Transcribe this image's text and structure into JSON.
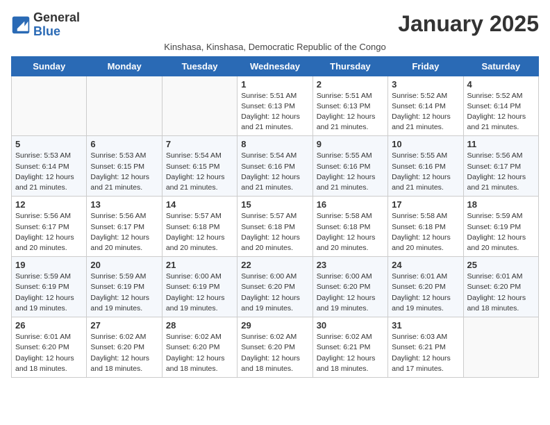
{
  "header": {
    "logo_general": "General",
    "logo_blue": "Blue",
    "month": "January 2025",
    "subtitle": "Kinshasa, Kinshasa, Democratic Republic of the Congo"
  },
  "weekdays": [
    "Sunday",
    "Monday",
    "Tuesday",
    "Wednesday",
    "Thursday",
    "Friday",
    "Saturday"
  ],
  "weeks": [
    [
      {
        "num": "",
        "info": ""
      },
      {
        "num": "",
        "info": ""
      },
      {
        "num": "",
        "info": ""
      },
      {
        "num": "1",
        "info": "Sunrise: 5:51 AM\nSunset: 6:13 PM\nDaylight: 12 hours\nand 21 minutes."
      },
      {
        "num": "2",
        "info": "Sunrise: 5:51 AM\nSunset: 6:13 PM\nDaylight: 12 hours\nand 21 minutes."
      },
      {
        "num": "3",
        "info": "Sunrise: 5:52 AM\nSunset: 6:14 PM\nDaylight: 12 hours\nand 21 minutes."
      },
      {
        "num": "4",
        "info": "Sunrise: 5:52 AM\nSunset: 6:14 PM\nDaylight: 12 hours\nand 21 minutes."
      }
    ],
    [
      {
        "num": "5",
        "info": "Sunrise: 5:53 AM\nSunset: 6:14 PM\nDaylight: 12 hours\nand 21 minutes."
      },
      {
        "num": "6",
        "info": "Sunrise: 5:53 AM\nSunset: 6:15 PM\nDaylight: 12 hours\nand 21 minutes."
      },
      {
        "num": "7",
        "info": "Sunrise: 5:54 AM\nSunset: 6:15 PM\nDaylight: 12 hours\nand 21 minutes."
      },
      {
        "num": "8",
        "info": "Sunrise: 5:54 AM\nSunset: 6:16 PM\nDaylight: 12 hours\nand 21 minutes."
      },
      {
        "num": "9",
        "info": "Sunrise: 5:55 AM\nSunset: 6:16 PM\nDaylight: 12 hours\nand 21 minutes."
      },
      {
        "num": "10",
        "info": "Sunrise: 5:55 AM\nSunset: 6:16 PM\nDaylight: 12 hours\nand 21 minutes."
      },
      {
        "num": "11",
        "info": "Sunrise: 5:56 AM\nSunset: 6:17 PM\nDaylight: 12 hours\nand 21 minutes."
      }
    ],
    [
      {
        "num": "12",
        "info": "Sunrise: 5:56 AM\nSunset: 6:17 PM\nDaylight: 12 hours\nand 20 minutes."
      },
      {
        "num": "13",
        "info": "Sunrise: 5:56 AM\nSunset: 6:17 PM\nDaylight: 12 hours\nand 20 minutes."
      },
      {
        "num": "14",
        "info": "Sunrise: 5:57 AM\nSunset: 6:18 PM\nDaylight: 12 hours\nand 20 minutes."
      },
      {
        "num": "15",
        "info": "Sunrise: 5:57 AM\nSunset: 6:18 PM\nDaylight: 12 hours\nand 20 minutes."
      },
      {
        "num": "16",
        "info": "Sunrise: 5:58 AM\nSunset: 6:18 PM\nDaylight: 12 hours\nand 20 minutes."
      },
      {
        "num": "17",
        "info": "Sunrise: 5:58 AM\nSunset: 6:18 PM\nDaylight: 12 hours\nand 20 minutes."
      },
      {
        "num": "18",
        "info": "Sunrise: 5:59 AM\nSunset: 6:19 PM\nDaylight: 12 hours\nand 20 minutes."
      }
    ],
    [
      {
        "num": "19",
        "info": "Sunrise: 5:59 AM\nSunset: 6:19 PM\nDaylight: 12 hours\nand 19 minutes."
      },
      {
        "num": "20",
        "info": "Sunrise: 5:59 AM\nSunset: 6:19 PM\nDaylight: 12 hours\nand 19 minutes."
      },
      {
        "num": "21",
        "info": "Sunrise: 6:00 AM\nSunset: 6:19 PM\nDaylight: 12 hours\nand 19 minutes."
      },
      {
        "num": "22",
        "info": "Sunrise: 6:00 AM\nSunset: 6:20 PM\nDaylight: 12 hours\nand 19 minutes."
      },
      {
        "num": "23",
        "info": "Sunrise: 6:00 AM\nSunset: 6:20 PM\nDaylight: 12 hours\nand 19 minutes."
      },
      {
        "num": "24",
        "info": "Sunrise: 6:01 AM\nSunset: 6:20 PM\nDaylight: 12 hours\nand 19 minutes."
      },
      {
        "num": "25",
        "info": "Sunrise: 6:01 AM\nSunset: 6:20 PM\nDaylight: 12 hours\nand 18 minutes."
      }
    ],
    [
      {
        "num": "26",
        "info": "Sunrise: 6:01 AM\nSunset: 6:20 PM\nDaylight: 12 hours\nand 18 minutes."
      },
      {
        "num": "27",
        "info": "Sunrise: 6:02 AM\nSunset: 6:20 PM\nDaylight: 12 hours\nand 18 minutes."
      },
      {
        "num": "28",
        "info": "Sunrise: 6:02 AM\nSunset: 6:20 PM\nDaylight: 12 hours\nand 18 minutes."
      },
      {
        "num": "29",
        "info": "Sunrise: 6:02 AM\nSunset: 6:20 PM\nDaylight: 12 hours\nand 18 minutes."
      },
      {
        "num": "30",
        "info": "Sunrise: 6:02 AM\nSunset: 6:21 PM\nDaylight: 12 hours\nand 18 minutes."
      },
      {
        "num": "31",
        "info": "Sunrise: 6:03 AM\nSunset: 6:21 PM\nDaylight: 12 hours\nand 17 minutes."
      },
      {
        "num": "",
        "info": ""
      }
    ]
  ]
}
